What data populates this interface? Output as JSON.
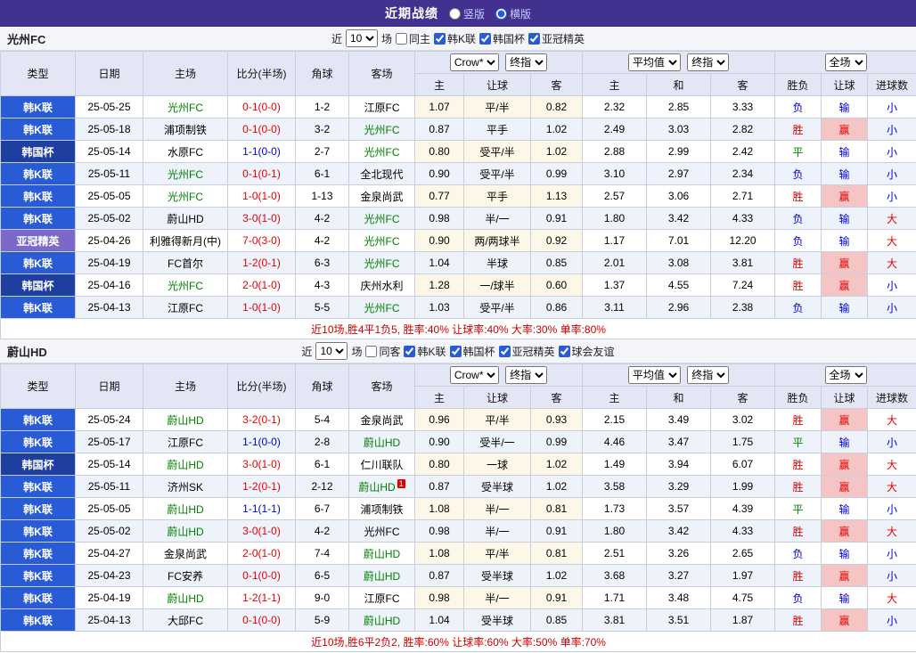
{
  "page": {
    "title": "近期战绩",
    "layout_options": [
      {
        "label": "竖版",
        "selected": false
      },
      {
        "label": "横版",
        "selected": true
      }
    ]
  },
  "colors": {
    "type_colors": {
      "韩K联": "#2a5bd7",
      "韩国杯": "#1e3f9f",
      "亚冠精英": "#7b68c8"
    },
    "focus_team": "#008000",
    "red": "#e60000",
    "blue": "#0000cc",
    "draw_green": "#008800",
    "win_bg": "#f5c5c5",
    "topbar_bg": "#42318f"
  },
  "sections": [
    {
      "team": "光州FC",
      "filters": {
        "prefix": "近",
        "count": "10",
        "suffix": "场",
        "checkboxes": [
          {
            "label": "同主",
            "checked": false
          },
          {
            "label": "韩K联",
            "checked": true
          },
          {
            "label": "韩国杯",
            "checked": true
          },
          {
            "label": "亚冠精英",
            "checked": true
          }
        ]
      },
      "header": {
        "left_cols": [
          "类型",
          "日期",
          "主场",
          "比分(半场)",
          "角球",
          "客场"
        ],
        "dd1": [
          "Crow*",
          "终指"
        ],
        "dd2": [
          "平均值",
          "终指"
        ],
        "dd3": [
          "全场"
        ],
        "sub_cols": [
          "主",
          "让球",
          "客",
          "主",
          "和",
          "客",
          "胜负",
          "让球",
          "进球数"
        ]
      },
      "rows": [
        {
          "type": "韩K联",
          "date": "25-05-25",
          "home": "光州FC",
          "home_focus": true,
          "score": "0-1(0-0)",
          "score_color": "red",
          "corner": "1-2",
          "away": "江原FC",
          "away_focus": false,
          "odds1": [
            "1.07",
            "平/半",
            "0.82"
          ],
          "odds2": [
            "2.32",
            "2.85",
            "3.33"
          ],
          "result": "负",
          "handicap_result": "输",
          "goals": "小"
        },
        {
          "type": "韩K联",
          "date": "25-05-18",
          "home": "浦项制铁",
          "home_focus": false,
          "score": "0-1(0-0)",
          "score_color": "red",
          "corner": "3-2",
          "away": "光州FC",
          "away_focus": true,
          "odds1": [
            "0.87",
            "平手",
            "1.02"
          ],
          "odds2": [
            "2.49",
            "3.03",
            "2.82"
          ],
          "result": "胜",
          "handicap_result": "赢",
          "goals": "小"
        },
        {
          "type": "韩国杯",
          "date": "25-05-14",
          "home": "水原FC",
          "home_focus": false,
          "score": "1-1(0-0)",
          "score_color": "blue",
          "corner": "2-7",
          "away": "光州FC",
          "away_focus": true,
          "odds1": [
            "0.80",
            "受平/半",
            "1.02"
          ],
          "odds2": [
            "2.88",
            "2.99",
            "2.42"
          ],
          "result": "平",
          "handicap_result": "输",
          "goals": "小"
        },
        {
          "type": "韩K联",
          "date": "25-05-11",
          "home": "光州FC",
          "home_focus": true,
          "score": "0-1(0-1)",
          "score_color": "red",
          "corner": "6-1",
          "away": "全北现代",
          "away_focus": false,
          "odds1": [
            "0.90",
            "受平/半",
            "0.99"
          ],
          "odds2": [
            "3.10",
            "2.97",
            "2.34"
          ],
          "result": "负",
          "handicap_result": "输",
          "goals": "小"
        },
        {
          "type": "韩K联",
          "date": "25-05-05",
          "home": "光州FC",
          "home_focus": true,
          "score": "1-0(1-0)",
          "score_color": "red",
          "corner": "1-13",
          "away": "金泉尚武",
          "away_focus": false,
          "odds1": [
            "0.77",
            "平手",
            "1.13"
          ],
          "odds2": [
            "2.57",
            "3.06",
            "2.71"
          ],
          "result": "胜",
          "handicap_result": "赢",
          "goals": "小"
        },
        {
          "type": "韩K联",
          "date": "25-05-02",
          "home": "蔚山HD",
          "home_focus": false,
          "score": "3-0(1-0)",
          "score_color": "red",
          "corner": "4-2",
          "away": "光州FC",
          "away_focus": true,
          "odds1": [
            "0.98",
            "半/一",
            "0.91"
          ],
          "odds2": [
            "1.80",
            "3.42",
            "4.33"
          ],
          "result": "负",
          "handicap_result": "输",
          "goals": "大"
        },
        {
          "type": "亚冠精英",
          "date": "25-04-26",
          "home": "利雅得新月(中)",
          "home_focus": false,
          "score": "7-0(3-0)",
          "score_color": "red",
          "corner": "4-2",
          "away": "光州FC",
          "away_focus": true,
          "odds1": [
            "0.90",
            "两/两球半",
            "0.92"
          ],
          "odds2": [
            "1.17",
            "7.01",
            "12.20"
          ],
          "result": "负",
          "handicap_result": "输",
          "goals": "大"
        },
        {
          "type": "韩K联",
          "date": "25-04-19",
          "home": "FC首尔",
          "home_focus": false,
          "score": "1-2(0-1)",
          "score_color": "red",
          "corner": "6-3",
          "away": "光州FC",
          "away_focus": true,
          "odds1": [
            "1.04",
            "半球",
            "0.85"
          ],
          "odds2": [
            "2.01",
            "3.08",
            "3.81"
          ],
          "result": "胜",
          "handicap_result": "赢",
          "goals": "大"
        },
        {
          "type": "韩国杯",
          "date": "25-04-16",
          "home": "光州FC",
          "home_focus": true,
          "score": "2-0(1-0)",
          "score_color": "red",
          "corner": "4-3",
          "away": "庆州水利",
          "away_focus": false,
          "odds1": [
            "1.28",
            "一/球半",
            "0.60"
          ],
          "odds2": [
            "1.37",
            "4.55",
            "7.24"
          ],
          "result": "胜",
          "handicap_result": "赢",
          "goals": "小"
        },
        {
          "type": "韩K联",
          "date": "25-04-13",
          "home": "江原FC",
          "home_focus": false,
          "score": "1-0(1-0)",
          "score_color": "red",
          "corner": "5-5",
          "away": "光州FC",
          "away_focus": true,
          "odds1": [
            "1.03",
            "受平/半",
            "0.86"
          ],
          "odds2": [
            "3.11",
            "2.96",
            "2.38"
          ],
          "result": "负",
          "handicap_result": "输",
          "goals": "小"
        }
      ],
      "summary": "近10场,胜4平1负5, 胜率:40% 让球率:40% 大率:30% 单率:80%"
    },
    {
      "team": "蔚山HD",
      "filters": {
        "prefix": "近",
        "count": "10",
        "suffix": "场",
        "checkboxes": [
          {
            "label": "同客",
            "checked": false
          },
          {
            "label": "韩K联",
            "checked": true
          },
          {
            "label": "韩国杯",
            "checked": true
          },
          {
            "label": "亚冠精英",
            "checked": true
          },
          {
            "label": "球会友谊",
            "checked": true
          }
        ]
      },
      "header": {
        "left_cols": [
          "类型",
          "日期",
          "主场",
          "比分(半场)",
          "角球",
          "客场"
        ],
        "dd1": [
          "Crow*",
          "终指"
        ],
        "dd2": [
          "平均值",
          "终指"
        ],
        "dd3": [
          "全场"
        ],
        "sub_cols": [
          "主",
          "让球",
          "客",
          "主",
          "和",
          "客",
          "胜负",
          "让球",
          "进球数"
        ]
      },
      "rows": [
        {
          "type": "韩K联",
          "date": "25-05-24",
          "home": "蔚山HD",
          "home_focus": true,
          "score": "3-2(0-1)",
          "score_color": "red",
          "corner": "5-4",
          "away": "金泉尚武",
          "away_focus": false,
          "odds1": [
            "0.96",
            "平/半",
            "0.93"
          ],
          "odds2": [
            "2.15",
            "3.49",
            "3.02"
          ],
          "result": "胜",
          "handicap_result": "赢",
          "goals": "大"
        },
        {
          "type": "韩K联",
          "date": "25-05-17",
          "home": "江原FC",
          "home_focus": false,
          "score": "1-1(0-0)",
          "score_color": "blue",
          "corner": "2-8",
          "away": "蔚山HD",
          "away_focus": true,
          "odds1": [
            "0.90",
            "受半/一",
            "0.99"
          ],
          "odds2": [
            "4.46",
            "3.47",
            "1.75"
          ],
          "result": "平",
          "handicap_result": "输",
          "goals": "小"
        },
        {
          "type": "韩国杯",
          "date": "25-05-14",
          "home": "蔚山HD",
          "home_focus": true,
          "score": "3-0(1-0)",
          "score_color": "red",
          "corner": "6-1",
          "away": "仁川联队",
          "away_focus": false,
          "odds1": [
            "0.80",
            "一球",
            "1.02"
          ],
          "odds2": [
            "1.49",
            "3.94",
            "6.07"
          ],
          "result": "胜",
          "handicap_result": "赢",
          "goals": "大"
        },
        {
          "type": "韩K联",
          "date": "25-05-11",
          "home": "济州SK",
          "home_focus": false,
          "score": "1-2(0-1)",
          "score_color": "red",
          "corner": "2-12",
          "away": "蔚山HD",
          "away_focus": true,
          "away_badge": "1",
          "odds1": [
            "0.87",
            "受半球",
            "1.02"
          ],
          "odds2": [
            "3.58",
            "3.29",
            "1.99"
          ],
          "result": "胜",
          "handicap_result": "赢",
          "goals": "大"
        },
        {
          "type": "韩K联",
          "date": "25-05-05",
          "home": "蔚山HD",
          "home_focus": true,
          "score": "1-1(1-1)",
          "score_color": "blue",
          "corner": "6-7",
          "away": "浦项制铁",
          "away_focus": false,
          "odds1": [
            "1.08",
            "半/一",
            "0.81"
          ],
          "odds2": [
            "1.73",
            "3.57",
            "4.39"
          ],
          "result": "平",
          "handicap_result": "输",
          "goals": "小"
        },
        {
          "type": "韩K联",
          "date": "25-05-02",
          "home": "蔚山HD",
          "home_focus": true,
          "score": "3-0(1-0)",
          "score_color": "red",
          "corner": "4-2",
          "away": "光州FC",
          "away_focus": false,
          "odds1": [
            "0.98",
            "半/一",
            "0.91"
          ],
          "odds2": [
            "1.80",
            "3.42",
            "4.33"
          ],
          "result": "胜",
          "handicap_result": "赢",
          "goals": "大"
        },
        {
          "type": "韩K联",
          "date": "25-04-27",
          "home": "金泉尚武",
          "home_focus": false,
          "score": "2-0(1-0)",
          "score_color": "red",
          "corner": "7-4",
          "away": "蔚山HD",
          "away_focus": true,
          "odds1": [
            "1.08",
            "平/半",
            "0.81"
          ],
          "odds2": [
            "2.51",
            "3.26",
            "2.65"
          ],
          "result": "负",
          "handicap_result": "输",
          "goals": "小"
        },
        {
          "type": "韩K联",
          "date": "25-04-23",
          "home": "FC安养",
          "home_focus": false,
          "score": "0-1(0-0)",
          "score_color": "red",
          "corner": "6-5",
          "away": "蔚山HD",
          "away_focus": true,
          "odds1": [
            "0.87",
            "受半球",
            "1.02"
          ],
          "odds2": [
            "3.68",
            "3.27",
            "1.97"
          ],
          "result": "胜",
          "handicap_result": "赢",
          "goals": "小"
        },
        {
          "type": "韩K联",
          "date": "25-04-19",
          "home": "蔚山HD",
          "home_focus": true,
          "score": "1-2(1-1)",
          "score_color": "red",
          "corner": "9-0",
          "away": "江原FC",
          "away_focus": false,
          "odds1": [
            "0.98",
            "半/一",
            "0.91"
          ],
          "odds2": [
            "1.71",
            "3.48",
            "4.75"
          ],
          "result": "负",
          "handicap_result": "输",
          "goals": "大"
        },
        {
          "type": "韩K联",
          "date": "25-04-13",
          "home": "大邱FC",
          "home_focus": false,
          "score": "0-1(0-0)",
          "score_color": "red",
          "corner": "5-9",
          "away": "蔚山HD",
          "away_focus": true,
          "odds1": [
            "1.04",
            "受半球",
            "0.85"
          ],
          "odds2": [
            "3.81",
            "3.51",
            "1.87"
          ],
          "result": "胜",
          "handicap_result": "赢",
          "goals": "小"
        }
      ],
      "summary": "近10场,胜6平2负2, 胜率:60% 让球率:60% 大率:50% 单率:70%"
    }
  ]
}
